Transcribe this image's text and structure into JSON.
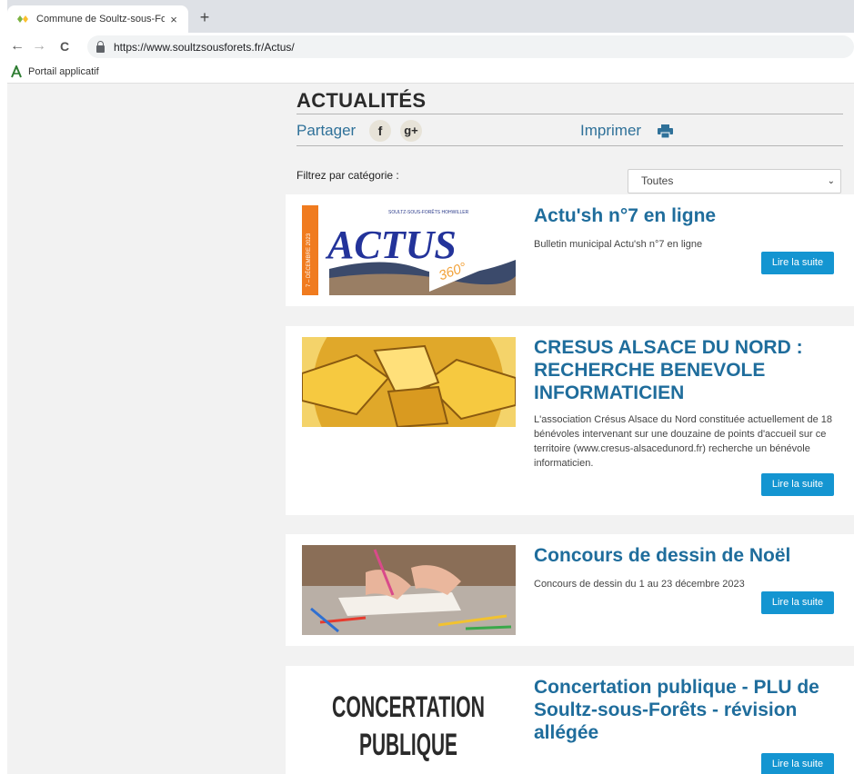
{
  "browser": {
    "tab_title": "Commune de Soultz-sous-Forêt",
    "tab_close": "×",
    "new_tab": "+",
    "url": "https://www.soultzsousforets.fr/Actus/",
    "bookmark": "Portail applicatif",
    "back": "←",
    "forward": "→",
    "reload": "C"
  },
  "page": {
    "heading": "ACTUALITÉS",
    "share_label": "Partager",
    "facebook_glyph": "f",
    "gplus_glyph": "g+",
    "print_label": "Imprimer",
    "filter_label": "Filtrez par catégorie :",
    "filter_value": "Toutes",
    "filter_chevron": "⌄"
  },
  "articles": [
    {
      "title": "Actu'sh n°7 en ligne",
      "description": "Bulletin municipal Actu'sh n°7 en ligne",
      "button": "Lire la suite",
      "image_text_top": "SOULTZ-SOUS-FORÊTS HOHWILLER",
      "image_text_main": "ACTUS",
      "image_text_360": "360°",
      "image_text_side": "7 – DÉCEMBRE 2023"
    },
    {
      "title": "CRESUS ALSACE DU NORD : RECHERCHE BENEVOLE INFORMATICIEN",
      "description": "L'association Crésus Alsace du Nord constituée actuellement de 18 bénévoles intervenant sur une douzaine de points d'accueil sur ce territoire (www.cresus-alsacedunord.fr) recherche un bénévole informaticien.",
      "button": "Lire la suite"
    },
    {
      "title": "Concours de dessin de Noël",
      "description": "Concours de dessin du 1 au 23 décembre 2023",
      "button": "Lire la suite"
    },
    {
      "title": "Concertation publique - PLU de Soultz-sous-Forêts - révision allégée",
      "description": "",
      "button": "Lire la suite",
      "image_line1": "CONCERTATION",
      "image_line2": "PUBLIQUE"
    }
  ],
  "colors": {
    "title_blue": "#1f6d9c",
    "button_blue": "#1495d1",
    "share_blue": "#2f7199",
    "page_bg": "#f2f2f2"
  }
}
